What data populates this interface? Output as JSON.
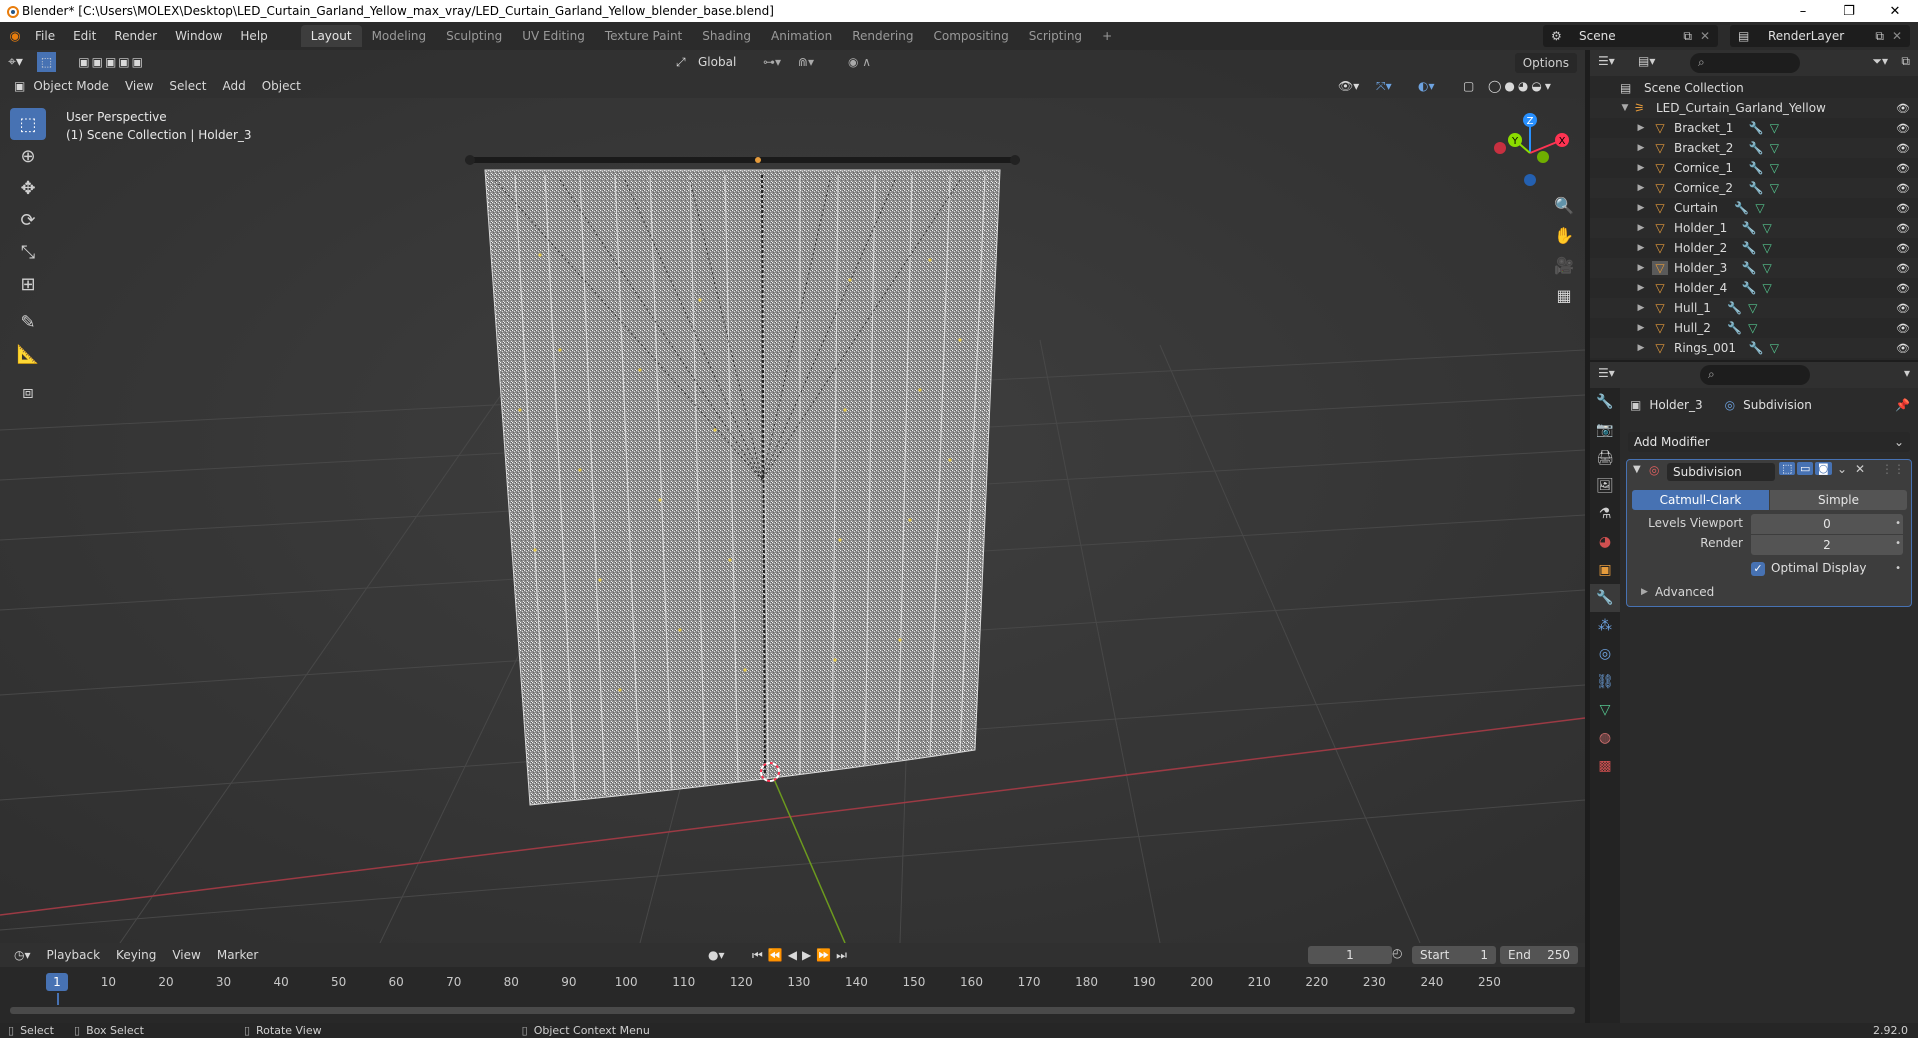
{
  "window": {
    "title": "Blender* [C:\\Users\\MOLEX\\Desktop\\LED_Curtain_Garland_Yellow_max_vray/LED_Curtain_Garland_Yellow_blender_base.blend]",
    "minimize": "–",
    "restore": "❐",
    "close": "✕"
  },
  "menu": [
    "File",
    "Edit",
    "Render",
    "Window",
    "Help"
  ],
  "workspaces": [
    "Layout",
    "Modeling",
    "Sculpting",
    "UV Editing",
    "Texture Paint",
    "Shading",
    "Animation",
    "Rendering",
    "Compositing",
    "Scripting",
    "+"
  ],
  "active_workspace": "Layout",
  "scene": "Scene",
  "render_layer": "RenderLayer",
  "viewport": {
    "mode": "Object Mode",
    "header_menu": [
      "View",
      "Select",
      "Add",
      "Object"
    ],
    "transform_orientation": "Global",
    "options": "Options",
    "perspective": "User Perspective",
    "collection_info": "(1) Scene Collection | Holder_3",
    "gizmo": {
      "x": "X",
      "y": "Y",
      "z": "Z"
    }
  },
  "timeline": {
    "menu": [
      "Playback",
      "Keying",
      "View",
      "Marker"
    ],
    "current_frame": "1",
    "start_label": "Start",
    "start": "1",
    "end_label": "End",
    "end": "250",
    "ticks": [
      "10",
      "20",
      "30",
      "40",
      "50",
      "60",
      "70",
      "80",
      "90",
      "100",
      "110",
      "120",
      "130",
      "140",
      "150",
      "160",
      "170",
      "180",
      "190",
      "200",
      "210",
      "220",
      "230",
      "240",
      "250"
    ],
    "cursor_frame": "1"
  },
  "statusbar": {
    "select": "Select",
    "box_select": "Box Select",
    "rotate": "Rotate View",
    "context": "Object Context Menu",
    "version": "2.92.0"
  },
  "outliner": {
    "root": "Scene Collection",
    "collection": "LED_Curtain_Garland_Yellow",
    "objects": [
      "Bracket_1",
      "Bracket_2",
      "Cornice_1",
      "Cornice_2",
      "Curtain",
      "Holder_1",
      "Holder_2",
      "Holder_3",
      "Holder_4",
      "Hull_1",
      "Hull_2",
      "Rings_001"
    ]
  },
  "properties": {
    "object_name": "Holder_3",
    "modifier_crumb": "Subdivision",
    "add_modifier": "Add Modifier",
    "modifier": {
      "name": "Subdivision",
      "type_options": [
        "Catmull-Clark",
        "Simple"
      ],
      "selected_type": "Catmull-Clark",
      "levels_viewport_label": "Levels Viewport",
      "levels_viewport": "0",
      "render_label": "Render",
      "render": "2",
      "optimal_display_label": "Optimal Display",
      "optimal_display": true,
      "advanced_label": "Advanced"
    }
  },
  "colors": {
    "accent": "#4772b3",
    "object_icon": "#e59b3c",
    "mesh_icon": "#55c48e",
    "x_axis": "#ff3352",
    "y_axis": "#8bdc00",
    "z_axis": "#2890ff"
  }
}
